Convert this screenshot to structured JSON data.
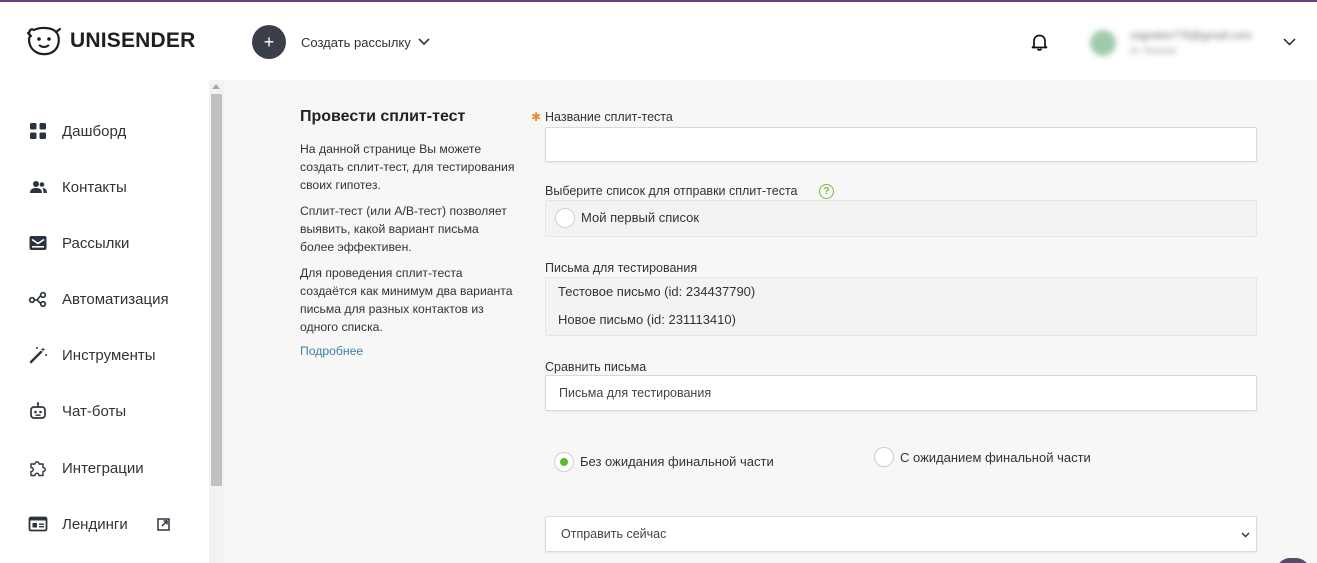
{
  "app": {
    "logo_text": "UNISENDER",
    "brand_color": "#6b3f7a",
    "accent_green": "#5cb82e"
  },
  "header": {
    "create_label": "Создать рассылку",
    "user_email": "zagrebin778@gmail.com",
    "user_sub": "ID 7843256"
  },
  "sidebar": {
    "items": [
      {
        "label": "Дашборд",
        "icon": "dashboard-icon"
      },
      {
        "label": "Контакты",
        "icon": "contacts-icon"
      },
      {
        "label": "Рассылки",
        "icon": "mail-icon"
      },
      {
        "label": "Автоматизация",
        "icon": "automation-icon"
      },
      {
        "label": "Инструменты",
        "icon": "magic-wand-icon"
      },
      {
        "label": "Чат-боты",
        "icon": "bot-icon"
      },
      {
        "label": "Интеграции",
        "icon": "puzzle-icon"
      },
      {
        "label": "Лендинги",
        "icon": "landing-icon"
      }
    ]
  },
  "info": {
    "title": "Провести сплит-тест",
    "p1": "На данной странице Вы можете создать сплит-тест, для тестирования своих гипотез.",
    "p2": "Сплит-тест (или А/В-тест) позволяет выявить, какой вариант письма более эффективен.",
    "p3": "Для проведения сплит-теста создаётся как минимум два варианта письма для разных контактов из одного списка.",
    "link": "Подробнее"
  },
  "form": {
    "name_label": "Название сплит-теста",
    "name_value": "",
    "list_label": "Выберите список для отправки сплит-теста",
    "list_option": "Мой первый список",
    "letters_label": "Письма для тестирования",
    "letters": [
      "Тестовое письмо (id: 234437790)",
      "Новое письмо (id: 231113410)"
    ],
    "compare_label": "Сравнить письма",
    "compare_placeholder": "Письма для тестирования",
    "radio_no_wait": "Без ожидания финальной части",
    "radio_wait": "С ожиданием финальной части",
    "send_option": "Отправить сейчас"
  }
}
